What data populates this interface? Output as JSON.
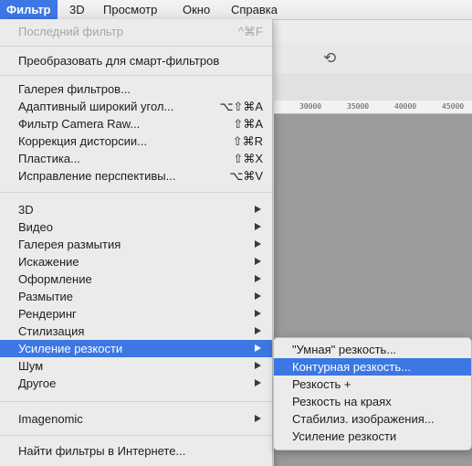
{
  "menubar": {
    "items": [
      {
        "label": "Фильтр",
        "active": true
      },
      {
        "label": "3D"
      },
      {
        "label": "Просмотр"
      },
      {
        "label": "Окно"
      },
      {
        "label": "Справка"
      }
    ]
  },
  "ruler": {
    "ticks": [
      "30000",
      "35000",
      "40000",
      "45000"
    ]
  },
  "filter_menu": {
    "last_filter": {
      "label": "Последний фильтр",
      "shortcut": "^⌘F"
    },
    "convert_smart": {
      "label": "Преобразовать для смарт-фильтров"
    },
    "gallery": {
      "label": "Галерея фильтров..."
    },
    "adaptive_wide": {
      "label": "Адаптивный широкий угол...",
      "shortcut": "⌥⇧⌘A"
    },
    "camera_raw": {
      "label": "Фильтр Camera Raw...",
      "shortcut": "⇧⌘A"
    },
    "lens_correction": {
      "label": "Коррекция дисторсии...",
      "shortcut": "⇧⌘R"
    },
    "liquify": {
      "label": "Пластика...",
      "shortcut": "⇧⌘X"
    },
    "vanishing_point": {
      "label": "Исправление перспективы...",
      "shortcut": "⌥⌘V"
    },
    "submenus": [
      {
        "label": "3D"
      },
      {
        "label": "Видео"
      },
      {
        "label": "Галерея размытия"
      },
      {
        "label": "Искажение"
      },
      {
        "label": "Оформление"
      },
      {
        "label": "Размытие"
      },
      {
        "label": "Рендеринг"
      },
      {
        "label": "Стилизация"
      },
      {
        "label": "Усиление резкости",
        "selected": true
      },
      {
        "label": "Шум"
      },
      {
        "label": "Другое"
      }
    ],
    "imagenomic": {
      "label": "Imagenomic"
    },
    "browse_online": {
      "label": "Найти фильтры в Интернете..."
    }
  },
  "sharpen_submenu": {
    "items": [
      {
        "label": "\"Умная\" резкость..."
      },
      {
        "label": "Контурная резкость...",
        "selected": true
      },
      {
        "label": "Резкость +"
      },
      {
        "label": "Резкость на краях"
      },
      {
        "label": "Стабилиз. изображения..."
      },
      {
        "label": "Усиление резкости"
      }
    ]
  },
  "colors": {
    "highlight": "#3c77e3",
    "menu_bg": "#ebebeb",
    "disabled_text": "#a6a6a6",
    "canvas_bg": "#9b9b9b"
  },
  "icons": {
    "undo": "undo-icon",
    "submenu_arrow": "submenu-arrow-icon"
  }
}
